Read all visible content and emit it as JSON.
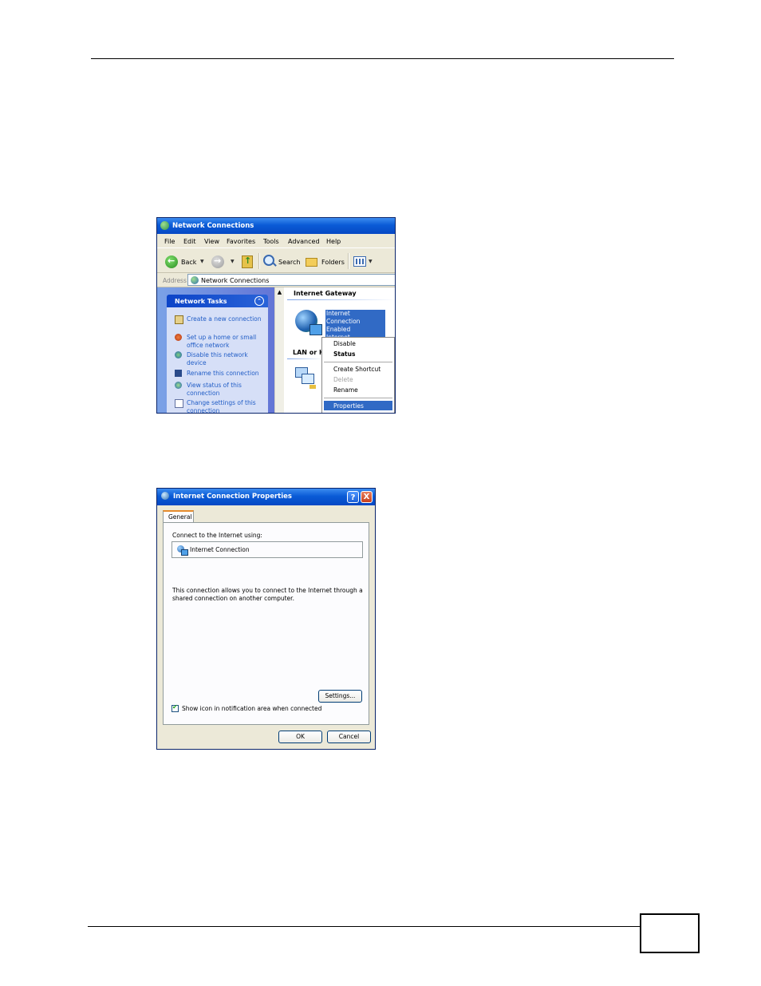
{
  "network_connections": {
    "title": "Network Connections",
    "menu": [
      "File",
      "Edit",
      "View",
      "Favorites",
      "Tools",
      "Advanced",
      "Help"
    ],
    "toolbar": {
      "back": "Back",
      "search": "Search",
      "folders": "Folders"
    },
    "address": {
      "label": "Address",
      "value": "Network Connections"
    },
    "tasks": {
      "heading": "Network Tasks",
      "items": [
        {
          "label": "Create a new connection",
          "icon": "new-connection-icon"
        },
        {
          "label": "Set up a home or small office network",
          "icon": "home-network-icon"
        },
        {
          "label": "Disable this network device",
          "icon": "disable-device-icon"
        },
        {
          "label": "Rename this connection",
          "icon": "rename-icon"
        },
        {
          "label": "View status of this connection",
          "icon": "status-icon"
        },
        {
          "label": "Change settings of this connection",
          "icon": "settings-icon"
        }
      ]
    },
    "groups": {
      "gateway": "Internet Gateway",
      "lan": "LAN or H"
    },
    "selected_item": {
      "name": "Internet Connection",
      "status": "Enabled",
      "type": "Internet Connection"
    },
    "context_menu": {
      "disable": "Disable",
      "status": "Status",
      "create_shortcut": "Create Shortcut",
      "delete": "Delete",
      "rename": "Rename",
      "properties": "Properties"
    }
  },
  "properties_dialog": {
    "title": "Internet Connection Properties",
    "tab": "General",
    "connect_label": "Connect to the Internet using:",
    "connection_name": "Internet Connection",
    "description": "This connection allows you to connect to the Internet through a shared connection on another computer.",
    "settings_button": "Settings...",
    "show_icon_label": "Show icon in notification area when connected",
    "show_icon_checked": true,
    "ok_button": "OK",
    "cancel_button": "Cancel",
    "help_button": "?",
    "close_button": "X"
  },
  "colors": {
    "titlebar": "#0548c4",
    "selection": "#316ac5",
    "task_link": "#215dc6"
  }
}
